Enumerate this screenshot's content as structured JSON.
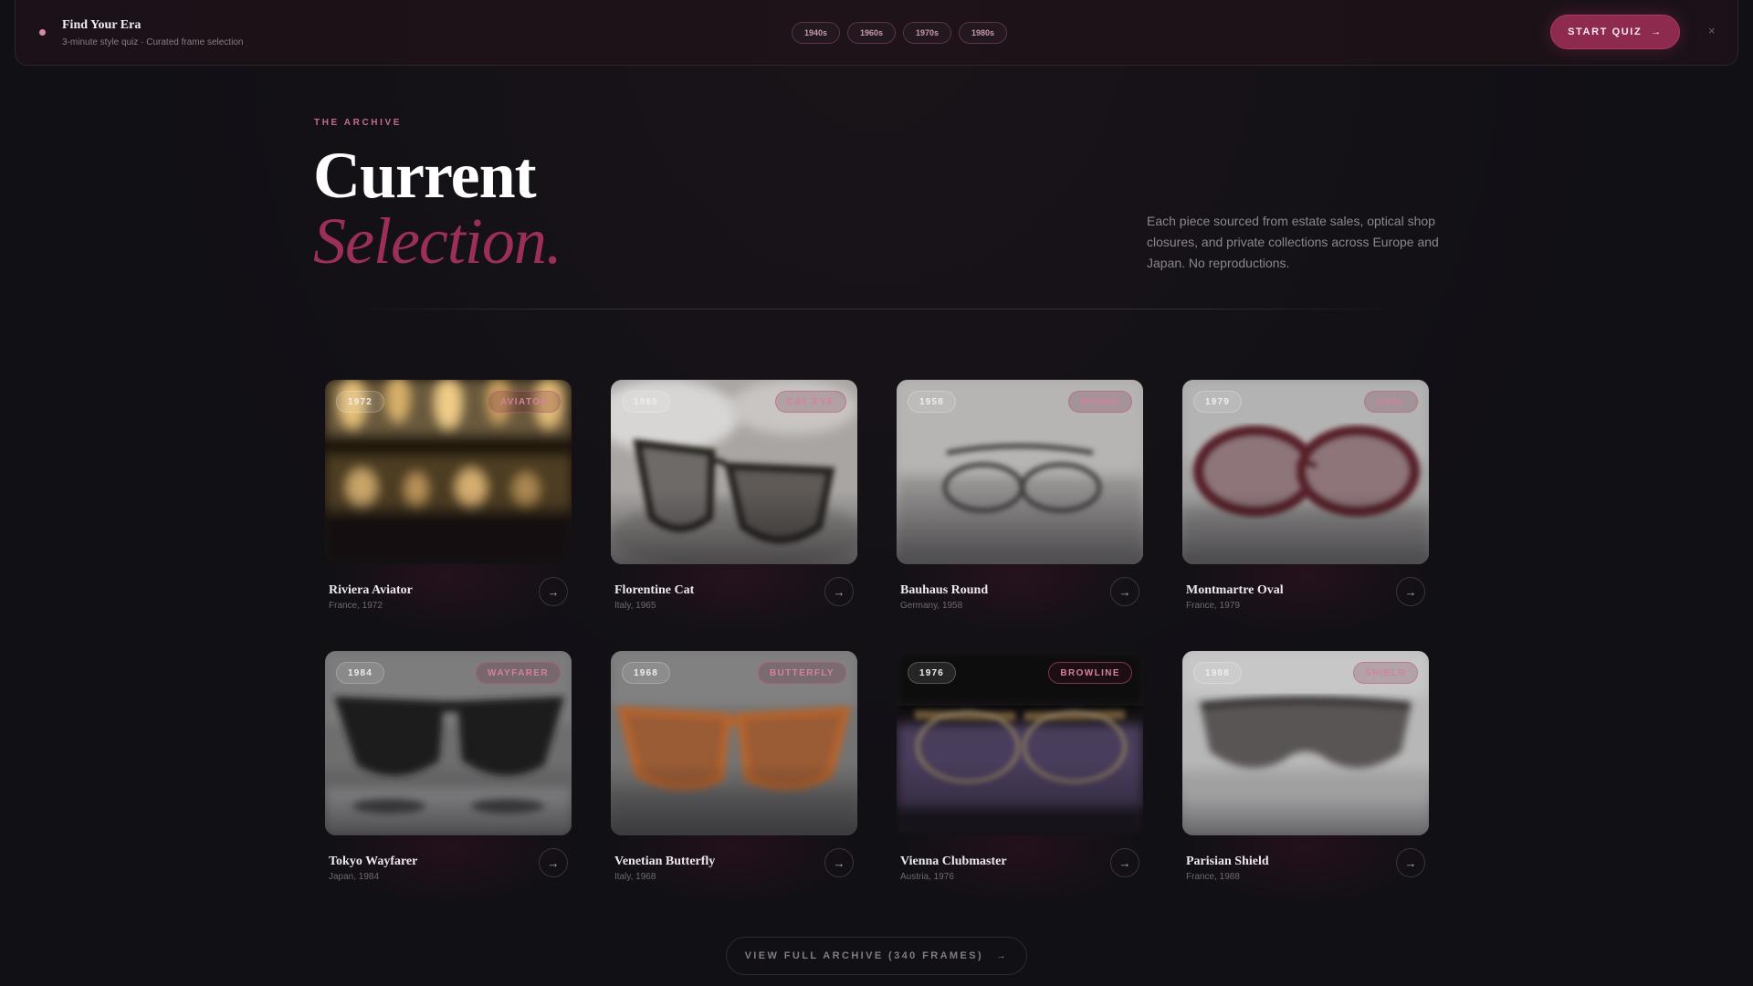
{
  "topbar": {
    "title": "Find Your Era",
    "subtitle": "3-minute style quiz · Curated frame selection",
    "eras": [
      "1940s",
      "1960s",
      "1970s",
      "1980s"
    ],
    "quiz_label": "START QUIZ",
    "quiz_icon": "arrow-right-icon",
    "close_label": "×"
  },
  "hero": {
    "eyebrow": "THE ARCHIVE",
    "title_line1": "Current",
    "title_line2": "Selection.",
    "description": "Each piece sourced from estate sales, optical shop closures, and private collections across Europe and Japan. No reproductions."
  },
  "frames": [
    {
      "year": "1972",
      "style": "AVIATOR",
      "name": "Riviera Aviator",
      "meta": "France, 1972"
    },
    {
      "year": "1965",
      "style": "CAT EYE",
      "name": "Florentine Cat",
      "meta": "Italy, 1965"
    },
    {
      "year": "1958",
      "style": "ROUND",
      "name": "Bauhaus Round",
      "meta": "Germany, 1958"
    },
    {
      "year": "1979",
      "style": "OVAL",
      "name": "Montmartre Oval",
      "meta": "France, 1979"
    },
    {
      "year": "1984",
      "style": "WAYFARER",
      "name": "Tokyo Wayfarer",
      "meta": "Japan, 1984"
    },
    {
      "year": "1968",
      "style": "BUTTERFLY",
      "name": "Venetian Butterfly",
      "meta": "Italy, 1968"
    },
    {
      "year": "1976",
      "style": "BROWLINE",
      "name": "Vienna Clubmaster",
      "meta": "Austria, 1976"
    },
    {
      "year": "1988",
      "style": "SHIELD",
      "name": "Parisian Shield",
      "meta": "France, 1988"
    }
  ],
  "archive_button": "VIEW FULL ARCHIVE (340 FRAMES)",
  "colors": {
    "background": "#111015",
    "accent": "#9c2f58",
    "accent_light": "#d5809f"
  }
}
